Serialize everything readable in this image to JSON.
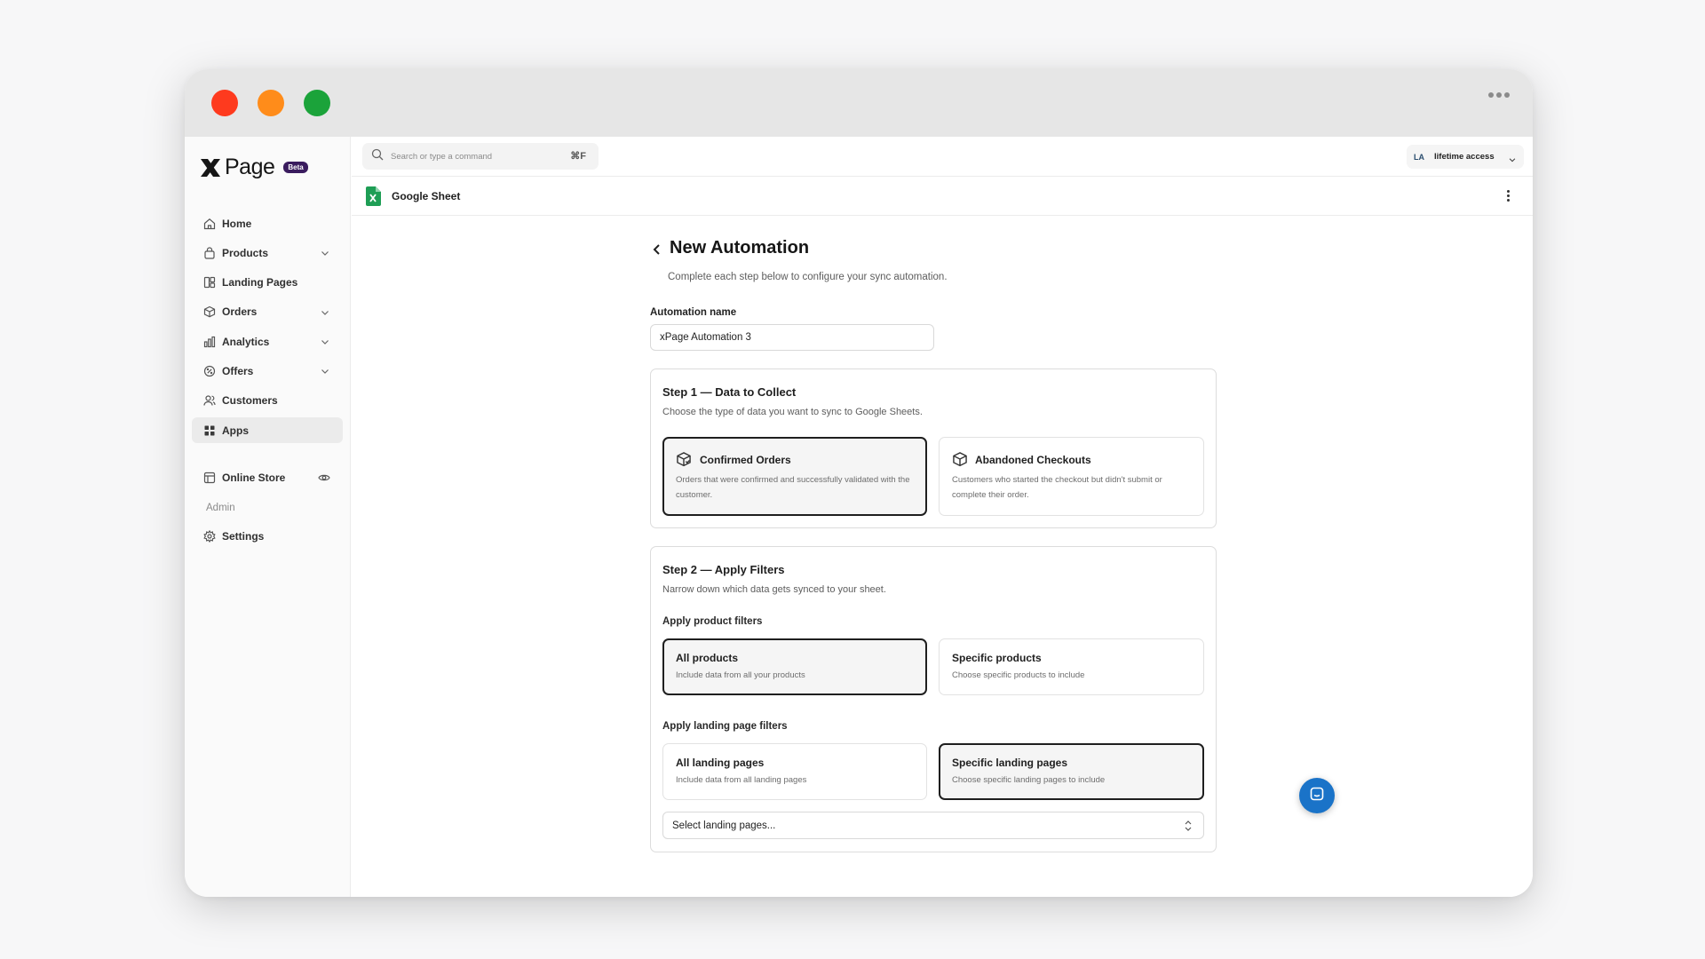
{
  "window": {
    "controls": [
      "close",
      "minimize",
      "maximize"
    ],
    "colors": {
      "close": "#fe3a1e",
      "minimize": "#ff8c1a",
      "maximize": "#1ba33a"
    }
  },
  "brand": {
    "logo_text": "Page",
    "logo_mark": "X",
    "badge": "Beta",
    "badge_color": "#3a1c5e"
  },
  "sidebar": {
    "items": [
      {
        "label": "Home",
        "icon": "home-icon"
      },
      {
        "label": "Products",
        "icon": "bag-icon",
        "expandable": true
      },
      {
        "label": "Landing Pages",
        "icon": "layout-icon"
      },
      {
        "label": "Orders",
        "icon": "box-icon",
        "expandable": true
      },
      {
        "label": "Analytics",
        "icon": "bar-chart-icon",
        "expandable": true
      },
      {
        "label": "Offers",
        "icon": "discount-icon",
        "expandable": true
      },
      {
        "label": "Customers",
        "icon": "users-icon"
      },
      {
        "label": "Apps",
        "icon": "apps-icon",
        "active": true
      }
    ],
    "online_store": {
      "label": "Online Store",
      "icon": "store-icon"
    },
    "section_label": "Admin",
    "settings": {
      "label": "Settings",
      "icon": "gear-icon"
    }
  },
  "topbar": {
    "search_placeholder": "Search or type a command",
    "shortcut": "⌘F",
    "account": {
      "initials": "LA",
      "name": "lifetime access"
    }
  },
  "subbar": {
    "title": "Google Sheet"
  },
  "form": {
    "title": "New Automation",
    "subtitle": "Complete each step below to configure your sync automation.",
    "name_label": "Automation name",
    "name_value": "xPage Automation 3",
    "step1": {
      "title": "Step 1 — Data to Collect",
      "subtitle": "Choose the type of data you want to sync to Google Sheets.",
      "options": [
        {
          "title": "Confirmed Orders",
          "desc": "Orders that were confirmed and successfully validated with the customer.",
          "selected": true
        },
        {
          "title": "Abandoned Checkouts",
          "desc": "Customers who started the checkout but didn't submit or complete their order.",
          "selected": false
        }
      ]
    },
    "step2": {
      "title": "Step 2 — Apply Filters",
      "subtitle": "Narrow down which data gets synced to your sheet.",
      "product_filters_label": "Apply product filters",
      "product_options": [
        {
          "title": "All products",
          "desc": "Include data from all your products",
          "selected": true
        },
        {
          "title": "Specific products",
          "desc": "Choose specific products to include",
          "selected": false
        }
      ],
      "landing_filters_label": "Apply landing page filters",
      "landing_options": [
        {
          "title": "All landing pages",
          "desc": "Include data from all landing pages",
          "selected": false
        },
        {
          "title": "Specific landing pages",
          "desc": "Choose specific landing pages to include",
          "selected": true
        }
      ],
      "select_placeholder": "Select landing pages..."
    }
  },
  "chat": {
    "icon": "chat-icon",
    "color": "#1a73c8"
  }
}
